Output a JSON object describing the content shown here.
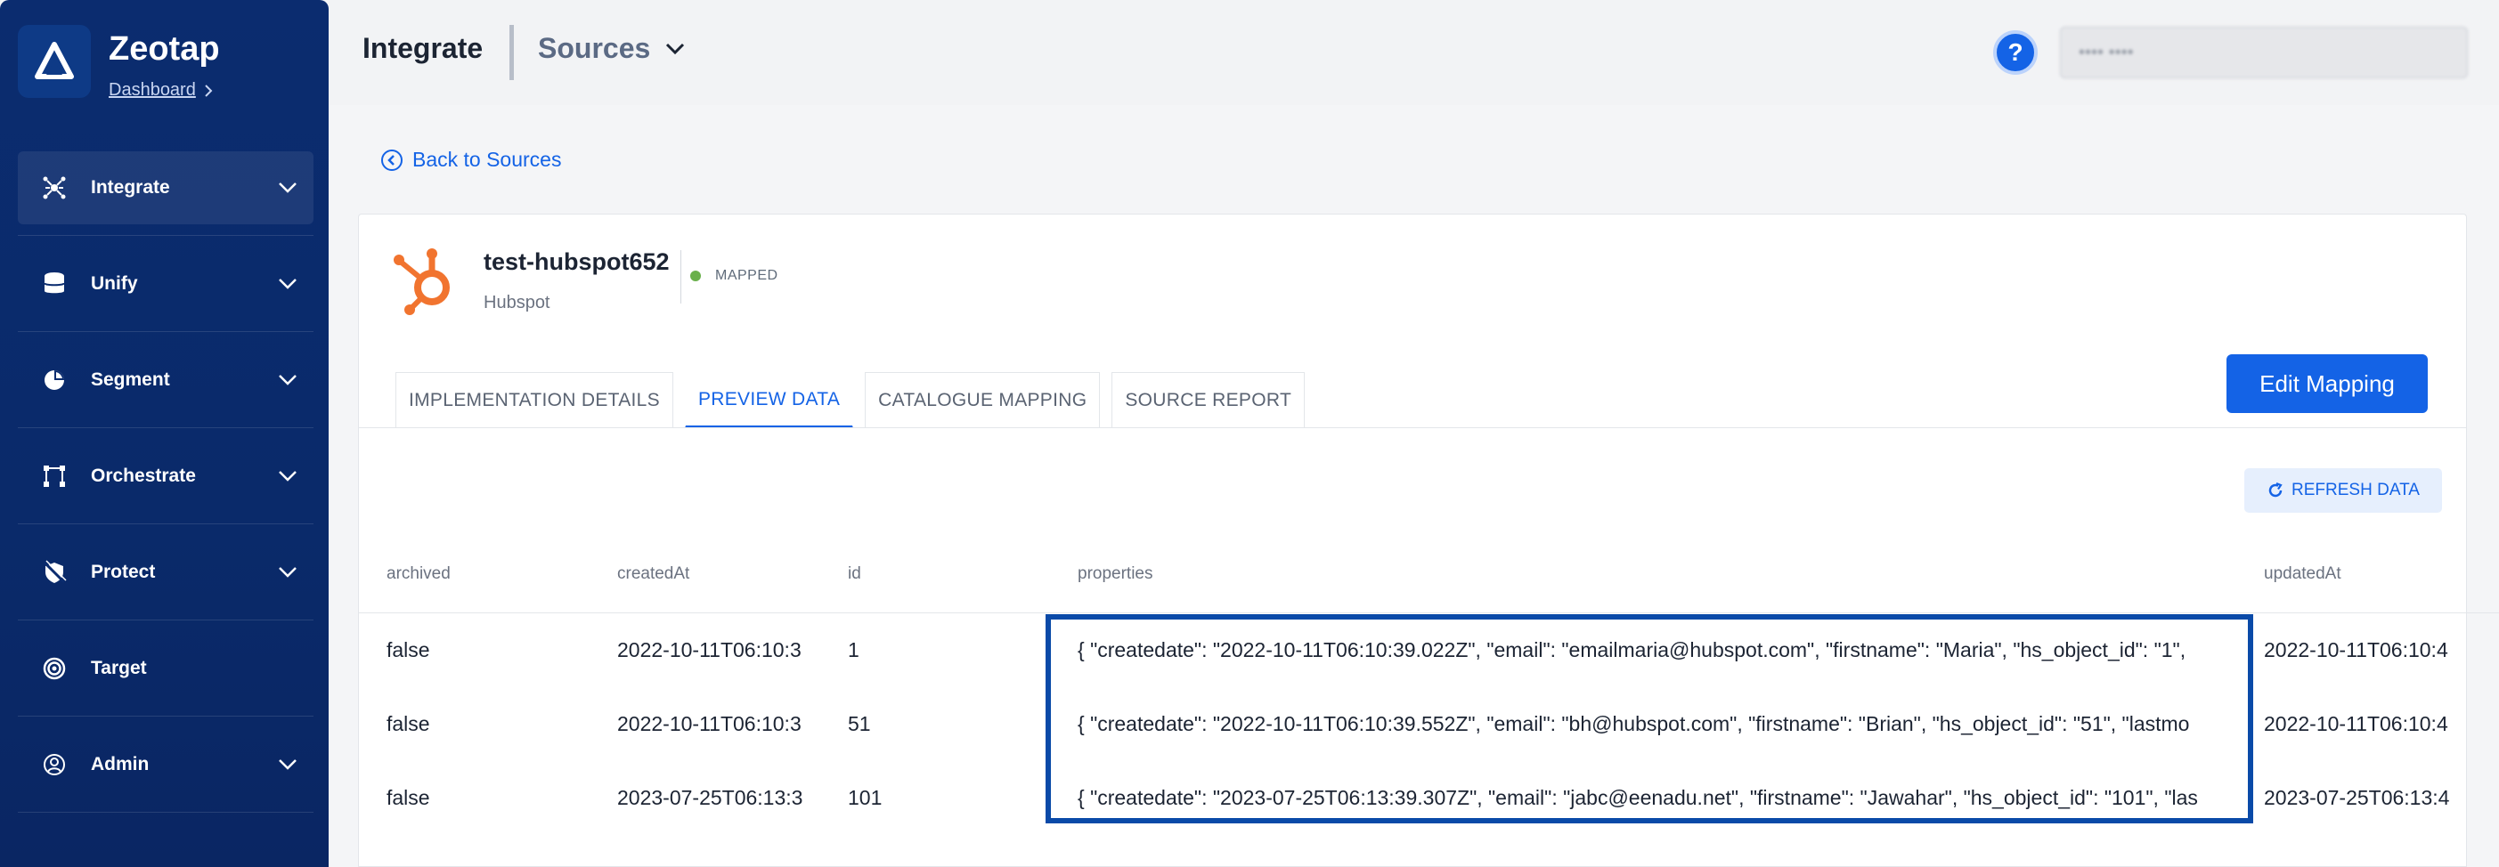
{
  "brand": {
    "name": "Zeotap",
    "link": "Dashboard"
  },
  "sidebar": {
    "items": [
      {
        "label": "Integrate",
        "icon": "integrate-icon",
        "chevron": true
      },
      {
        "label": "Unify",
        "icon": "database-icon",
        "chevron": true
      },
      {
        "label": "Segment",
        "icon": "pie-chart-icon",
        "chevron": true
      },
      {
        "label": "Orchestrate",
        "icon": "orchestrate-icon",
        "chevron": true
      },
      {
        "label": "Protect",
        "icon": "shield-off-icon",
        "chevron": true
      },
      {
        "label": "Target",
        "icon": "target-icon",
        "chevron": false
      },
      {
        "label": "Admin",
        "icon": "user-circle-icon",
        "chevron": true
      }
    ]
  },
  "header": {
    "title": "Integrate",
    "section": "Sources",
    "help": "?",
    "user": "•••• ••••"
  },
  "back_link": "Back to Sources",
  "source": {
    "name": "test-hubspot652",
    "type": "Hubspot",
    "status": "MAPPED"
  },
  "tabs": [
    {
      "label": "IMPLEMENTATION DETAILS"
    },
    {
      "label": "PREVIEW DATA"
    },
    {
      "label": "CATALOGUE MAPPING"
    },
    {
      "label": "SOURCE REPORT"
    }
  ],
  "edit_button": "Edit Mapping",
  "refresh_button": "REFRESH DATA",
  "table": {
    "columns": [
      "archived",
      "createdAt",
      "id",
      "properties",
      "updatedAt"
    ],
    "rows": [
      {
        "archived": "false",
        "createdAt": "2022-10-11T06:10:3",
        "id": "1",
        "properties": "{ \"createdate\": \"2022-10-11T06:10:39.022Z\", \"email\": \"emailmaria@hubspot.com\", \"firstname\": \"Maria\", \"hs_object_id\": \"1\",",
        "updatedAt": "2022-10-11T06:10:4"
      },
      {
        "archived": "false",
        "createdAt": "2022-10-11T06:10:3",
        "id": "51",
        "properties": "{ \"createdate\": \"2022-10-11T06:10:39.552Z\", \"email\": \"bh@hubspot.com\", \"firstname\": \"Brian\", \"hs_object_id\": \"51\", \"lastmo",
        "updatedAt": "2022-10-11T06:10:4"
      },
      {
        "archived": "false",
        "createdAt": "2023-07-25T06:13:3",
        "id": "101",
        "properties": "{ \"createdate\": \"2023-07-25T06:13:39.307Z\", \"email\": \"jabc@eenadu.net\", \"firstname\": \"Jawahar\", \"hs_object_id\": \"101\", \"las",
        "updatedAt": "2023-07-25T06:13:4"
      }
    ]
  },
  "colors": {
    "primary": "#1463e6",
    "sidebar": "#0b2c6f",
    "highlight": "#0a4aa8",
    "hubspot": "#f1742f",
    "mapped": "#6ab04c"
  }
}
